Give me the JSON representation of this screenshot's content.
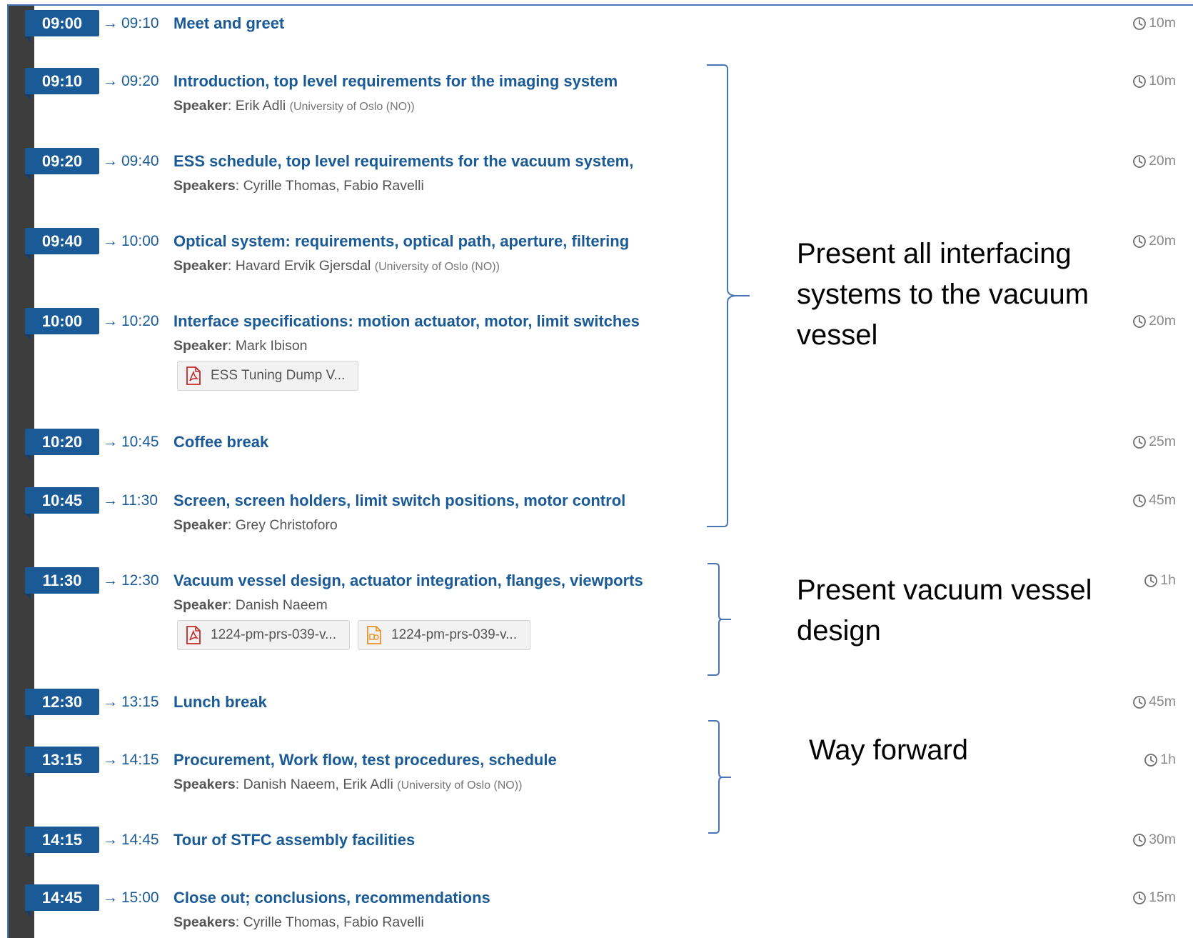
{
  "entries": [
    {
      "start": "09:00",
      "end": "09:10",
      "title": "Meet and greet",
      "duration": "10m"
    },
    {
      "start": "09:10",
      "end": "09:20",
      "title": "Introduction, top level requirements for the imaging system",
      "speaker_label": "Speaker",
      "speakers": "Erik Adli",
      "affiliation": "(University of Oslo (NO))",
      "duration": "10m"
    },
    {
      "start": "09:20",
      "end": "09:40",
      "title": "ESS schedule, top level requirements for the vacuum system,",
      "speaker_label": "Speakers",
      "speakers": "Cyrille Thomas, Fabio Ravelli",
      "duration": "20m"
    },
    {
      "start": "09:40",
      "end": "10:00",
      "title": "Optical system: requirements, optical path, aperture, filtering",
      "speaker_label": "Speaker",
      "speakers": "Havard Ervik Gjersdal",
      "affiliation": "(University of Oslo (NO))",
      "duration": "20m"
    },
    {
      "start": "10:00",
      "end": "10:20",
      "title": "Interface specifications: motion actuator, motor, limit switches",
      "speaker_label": "Speaker",
      "speakers": "Mark Ibison",
      "duration": "20m",
      "files": [
        {
          "type": "pdf",
          "name": "ESS Tuning Dump V..."
        }
      ]
    },
    {
      "start": "10:20",
      "end": "10:45",
      "title": "Coffee break",
      "duration": "25m"
    },
    {
      "start": "10:45",
      "end": "11:30",
      "title": "Screen, screen holders, limit switch positions, motor control",
      "speaker_label": "Speaker",
      "speakers": "Grey Christoforo",
      "duration": "45m"
    },
    {
      "start": "11:30",
      "end": "12:30",
      "title": "Vacuum vessel design, actuator integration, flanges, viewports",
      "speaker_label": "Speaker",
      "speakers": "Danish Naeem",
      "duration": "1h",
      "files": [
        {
          "type": "pdf",
          "name": "1224-pm-prs-039-v..."
        },
        {
          "type": "ppt",
          "name": "1224-pm-prs-039-v..."
        }
      ]
    },
    {
      "start": "12:30",
      "end": "13:15",
      "title": "Lunch break",
      "duration": "45m"
    },
    {
      "start": "13:15",
      "end": "14:15",
      "title": "Procurement, Work flow, test procedures, schedule",
      "speaker_label": "Speakers",
      "speakers": "Danish Naeem, Erik Adli",
      "affiliation": "(University of Oslo (NO))",
      "duration": "1h"
    },
    {
      "start": "14:15",
      "end": "14:45",
      "title": "Tour of STFC assembly facilities",
      "duration": "30m"
    },
    {
      "start": "14:45",
      "end": "15:00",
      "title": "Close out; conclusions, recommendations",
      "speaker_label": "Speakers",
      "speakers": "Cyrille Thomas, Fabio Ravelli",
      "duration": "15m"
    }
  ],
  "annotations": {
    "interfacing": "Present all interfacing systems to the vacuum vessel",
    "vessel": "Present vacuum vessel design",
    "forward": "Way forward"
  },
  "colors": {
    "badge": "#1a5a96",
    "title": "#1a5a96",
    "timeline": "#3d3d3d",
    "bracket": "#4a74b4",
    "pdf_icon": "#c62828",
    "ppt_icon": "#e8922a"
  },
  "icons": {
    "duration": "clock-icon",
    "pdf": "pdf-file-icon",
    "ppt": "presentation-file-icon",
    "arrow": "→"
  }
}
